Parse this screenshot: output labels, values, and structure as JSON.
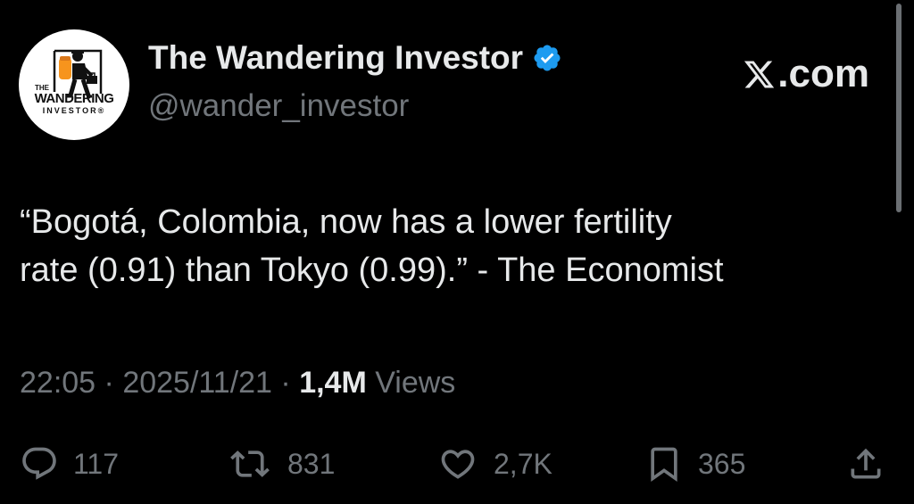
{
  "author": {
    "display_name": "The Wandering Investor",
    "handle": "@wander_investor",
    "verified": true,
    "avatar": {
      "logo_line1": "THE",
      "logo_line2": "WANDERING",
      "logo_line3": "INVESTOR®"
    }
  },
  "site": {
    "label": ".com",
    "icon": "x-logo-icon"
  },
  "tweet": {
    "line1": "“Bogotá, Colombia, now has a lower fertility",
    "line2": "rate (0.91) than Tokyo (0.99).” - The Economist"
  },
  "meta": {
    "time": "22:05",
    "separator": " · ",
    "date": "2025/11/21",
    "views_count": "1,4M",
    "views_label": " Views"
  },
  "actions": {
    "reply": {
      "icon": "reply-icon",
      "count": "117"
    },
    "retweet": {
      "icon": "retweet-icon",
      "count": "831"
    },
    "like": {
      "icon": "heart-icon",
      "count": "2,7K"
    },
    "bookmark": {
      "icon": "bookmark-icon",
      "count": "365"
    },
    "share": {
      "icon": "share-icon"
    }
  },
  "colors": {
    "background": "#000000",
    "text_primary": "#e7e9ea",
    "text_secondary": "#71767b",
    "verified_blue": "#1d9bf0",
    "logo_orange": "#f7941d"
  }
}
